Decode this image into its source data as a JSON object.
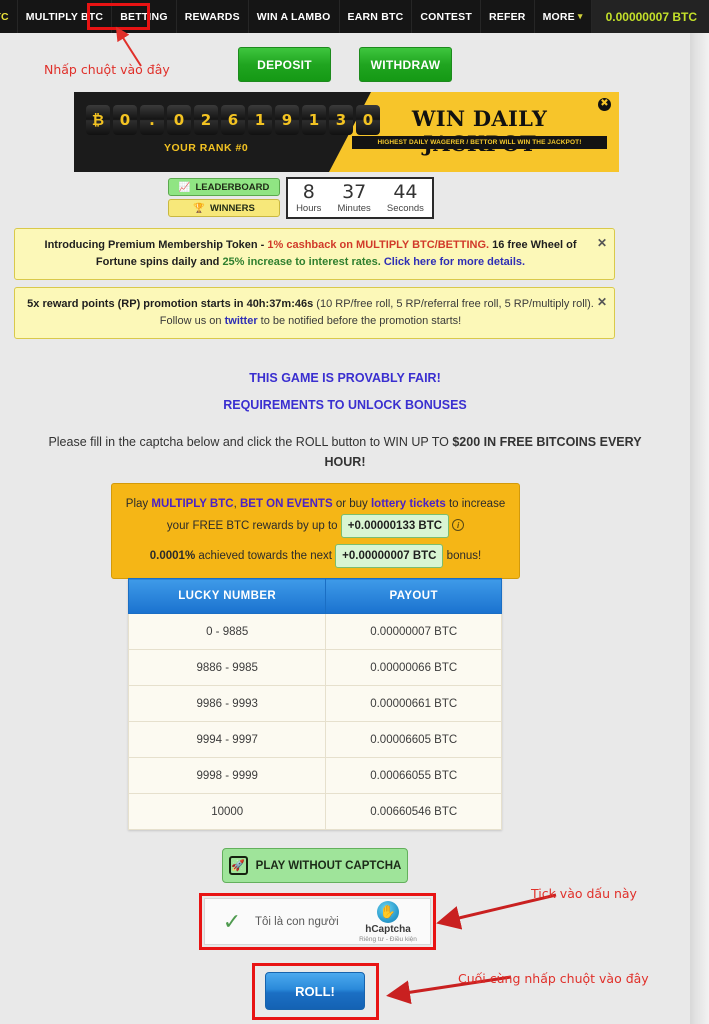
{
  "nav": {
    "items": [
      {
        "label": "FREE BTC",
        "active": true
      },
      {
        "label": "MULTIPLY BTC",
        "active": false
      },
      {
        "label": "BETTING",
        "active": false
      },
      {
        "label": "REWARDS",
        "active": false
      },
      {
        "label": "WIN A LAMBO",
        "active": false
      },
      {
        "label": "EARN BTC",
        "active": false
      },
      {
        "label": "CONTEST",
        "active": false
      },
      {
        "label": "REFER",
        "active": false
      },
      {
        "label": "MORE",
        "active": false
      }
    ],
    "more_chevron": "⌄⌄",
    "balance": "0.00000007 BTC"
  },
  "annotations": {
    "top": "Nhấp chuột vào đây",
    "captcha": "Tick vào dấu này",
    "roll": "Cuối cùng nhấp chuột vào đây"
  },
  "actions": {
    "deposit": "DEPOSIT",
    "withdraw": "WITHDRAW"
  },
  "jackpot": {
    "digits": [
      "₿",
      "0",
      ".",
      "0",
      "2",
      "6",
      "1",
      "9",
      "1",
      "3",
      "0"
    ],
    "rank": "YOUR RANK #0",
    "title": "WIN DAILY JACKPOT",
    "subtitle": "HIGHEST DAILY WAGERER / BETTOR WILL WIN THE JACKPOT!",
    "close": "✖"
  },
  "pills": {
    "leaderboard": "LEADERBOARD",
    "leaderboard_icon": "chart-icon",
    "winners": "WINNERS",
    "winners_icon": "trophy-icon"
  },
  "timer": {
    "units": [
      {
        "value": "8",
        "label": "Hours"
      },
      {
        "value": "37",
        "label": "Minutes"
      },
      {
        "value": "44",
        "label": "Seconds"
      }
    ]
  },
  "alert1": {
    "part1": "Introducing Premium Membership Token - ",
    "part2_red": "1% cashback on MULTIPLY BTC/BETTING.",
    "part3": " 16 free Wheel of Fortune spins daily",
    "part4": " and ",
    "part5_red": "25% increase to interest rates.",
    "part6_link": " Click here for more details.",
    "close": "✕"
  },
  "alert2": {
    "bold": "5x reward points (RP) promotion starts in 40h:37m:46s",
    "rest": " (10 RP/free roll, 5 RP/referral free roll, 5 RP/multiply roll).",
    "line2_pre": "Follow us on ",
    "line2_link": "twitter",
    "line2_post": " to be notified before the promotion starts!",
    "close": "✕"
  },
  "headings": {
    "provably_fair": "THIS GAME IS PROVABLY FAIR!",
    "requirements": "REQUIREMENTS TO UNLOCK BONUSES"
  },
  "intro": {
    "pre": "Please fill in the captcha below and click the ROLL button to WIN UP TO ",
    "bold": "$200 IN FREE BITCOINS EVERY HOUR!"
  },
  "promo": {
    "l1_pre": "Play ",
    "l1_link1": "MULTIPLY BTC",
    "l1_mid": ", ",
    "l1_link2": "BET ON EVENTS",
    "l1_mid2": " or buy ",
    "l1_link3": "lottery tickets",
    "l1_post": " to increase your FREE BTC rewards by up to ",
    "chip1": "+0.00000133 BTC",
    "info_icon": "i",
    "l2_pct": "0.0001%",
    "l2_mid": " achieved towards the next ",
    "chip2": "+0.00000007 BTC",
    "l2_post": " bonus!"
  },
  "table": {
    "headers": [
      "LUCKY NUMBER",
      "PAYOUT"
    ],
    "rows": [
      [
        "0 - 9885",
        "0.00000007 BTC"
      ],
      [
        "9886 - 9985",
        "0.00000066 BTC"
      ],
      [
        "9986 - 9993",
        "0.00000661 BTC"
      ],
      [
        "9994 - 9997",
        "0.00006605 BTC"
      ],
      [
        "9998 - 9999",
        "0.00066055 BTC"
      ],
      [
        "10000",
        "0.00660546 BTC"
      ]
    ]
  },
  "captcha": {
    "play_without": "PLAY WITHOUT CAPTCHA",
    "rocket_icon": "rocket-icon",
    "checkbox_label": "Tôi là con người",
    "brand": "hCaptcha",
    "legal": "Riêng tư - Điều kiện",
    "check_icon": "check-icon"
  },
  "roll": {
    "label": "ROLL!"
  }
}
